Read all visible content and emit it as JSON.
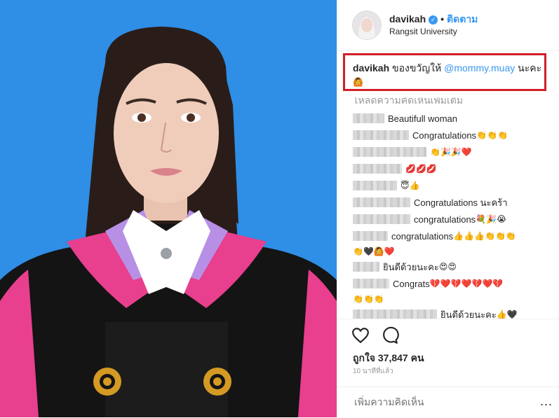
{
  "post": {
    "username": "davikah",
    "verified_icon": "verified-badge-icon",
    "separator": "•",
    "follow_label": "ติดตาม",
    "location": "Rangsit University"
  },
  "caption": {
    "username": "davikah",
    "text": "ของขวัญให้",
    "mention": "@mommy.muay",
    "suffix": "นะคะ",
    "emoji": "🙆"
  },
  "load_more": "โหลดความคิดเห็นเพิ่มเติม",
  "comments": [
    {
      "text": "Beautifull woman",
      "emoji": ""
    },
    {
      "text": "Congratulations",
      "emoji": "👏👏👏"
    },
    {
      "text": "",
      "emoji": "👏🎉🎉❤️"
    },
    {
      "text": "",
      "emoji": "💋💋💋"
    },
    {
      "text": "",
      "emoji": "😇👍"
    },
    {
      "text": "Congratulations นะคร้า",
      "emoji": ""
    },
    {
      "text": "congratulations",
      "emoji": "💐🎉😭"
    },
    {
      "text": "congratulations",
      "emoji": "👍👍👍👏👏👏"
    },
    {
      "text": "",
      "emoji": "👏🖤🙆❤️"
    },
    {
      "text": "ยินดีด้วยนะคะ",
      "emoji": "😍😍"
    },
    {
      "text": "Congrats",
      "emoji": "💔❤️💔❤️💔❤️💔"
    },
    {
      "text": "",
      "emoji": "👏👏👏"
    },
    {
      "text": "ยินดีด้วยนะคะ",
      "emoji": "👍🖤"
    }
  ],
  "actions": {
    "like_icon": "heart-icon",
    "comment_icon": "comment-icon",
    "likes_label": "ถูกใจ 37,847 คน",
    "time": "10 นาทีที่แล้ว",
    "add_comment_placeholder": "เพิ่มความคิดเห็น",
    "more_label": "..."
  }
}
